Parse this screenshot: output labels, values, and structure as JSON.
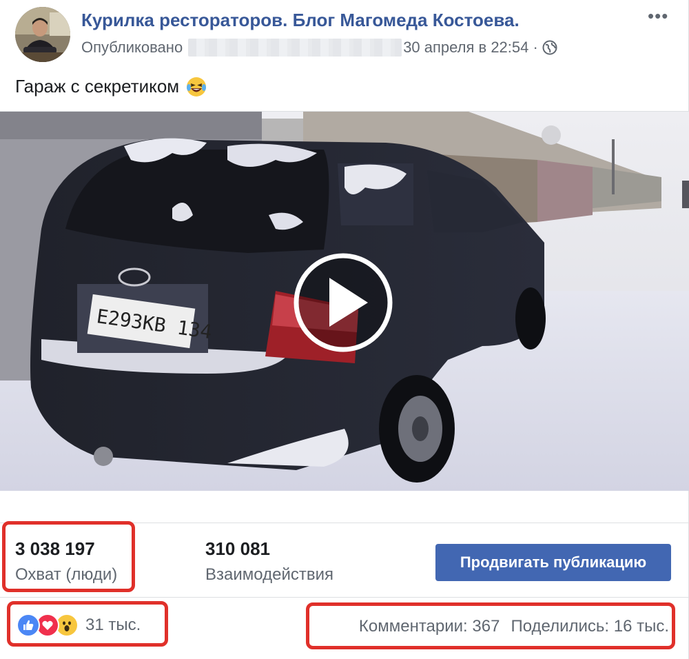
{
  "post": {
    "page_name": "Курилка рестораторов. Блог Магомеда Костоева.",
    "published_prefix": "Опубликовано",
    "published_date": "30 апреля в 22:54 ·",
    "more_icon": "more-horizontal-icon",
    "text": "Гараж с секретиком",
    "text_emoji": "laughing-tears-emoji"
  },
  "video": {
    "plate": "E293КВ 134",
    "play_icon": "play-icon"
  },
  "stats": {
    "reach_value": "3 038 197",
    "reach_label": "Охват (люди)",
    "engagement_value": "310 081",
    "engagement_label": "Взаимодействия",
    "promote_label": "Продвигать публикацию"
  },
  "reactions": {
    "count": "31 тыс.",
    "icons": [
      "like-icon",
      "love-icon",
      "wow-icon"
    ]
  },
  "engagement": {
    "comments": "Комментарии: 367",
    "shares": "Поделились: 16 тыс."
  },
  "colors": {
    "link": "#385898",
    "button": "#4267b2",
    "highlight": "#e0302a"
  }
}
